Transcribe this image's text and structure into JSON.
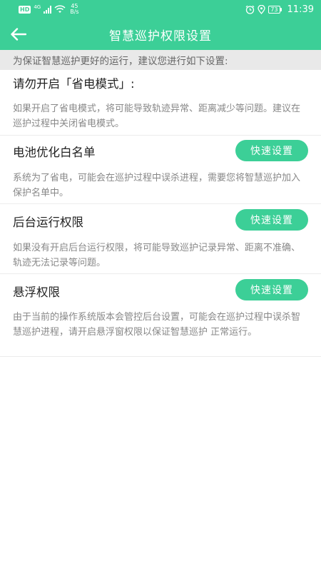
{
  "status_bar": {
    "hd": "HD",
    "network": "4G",
    "speed_value": "45",
    "speed_unit": "B/s",
    "battery": "73",
    "time": "11:39"
  },
  "app_bar": {
    "title": "智慧巡护权限设置"
  },
  "notice": "为保证智慧巡护更好的运行，建议您进行如下设置:",
  "sections": [
    {
      "title": "请勿开启「省电模式」:",
      "description": "如果开启了省电模式，将可能导致轨迹异常、距离减少等问题。建议在巡护过程中关闭省电模式。",
      "button": ""
    },
    {
      "title": "电池优化白名单",
      "description": "系统为了省电，可能会在巡护过程中误杀进程，需要您将智慧巡护加入保护名单中。",
      "button": "快速设置"
    },
    {
      "title": "后台运行权限",
      "description": "如果没有开启后台运行权限，将可能导致巡护记录异常、距离不准确、轨迹无法记录等问题。",
      "button": "快速设置"
    },
    {
      "title": "悬浮权限",
      "description": "由于当前的操作系统版本会管控后台设置，可能会在巡护过程中误杀智慧巡护进程，请开启悬浮窗权限以保证智慧巡护 正常运行。",
      "button": "快速设置"
    }
  ],
  "colors": {
    "primary": "#3ccf97",
    "notice_bg": "#e9e9e9",
    "text": "#222222",
    "muted": "#888888"
  }
}
